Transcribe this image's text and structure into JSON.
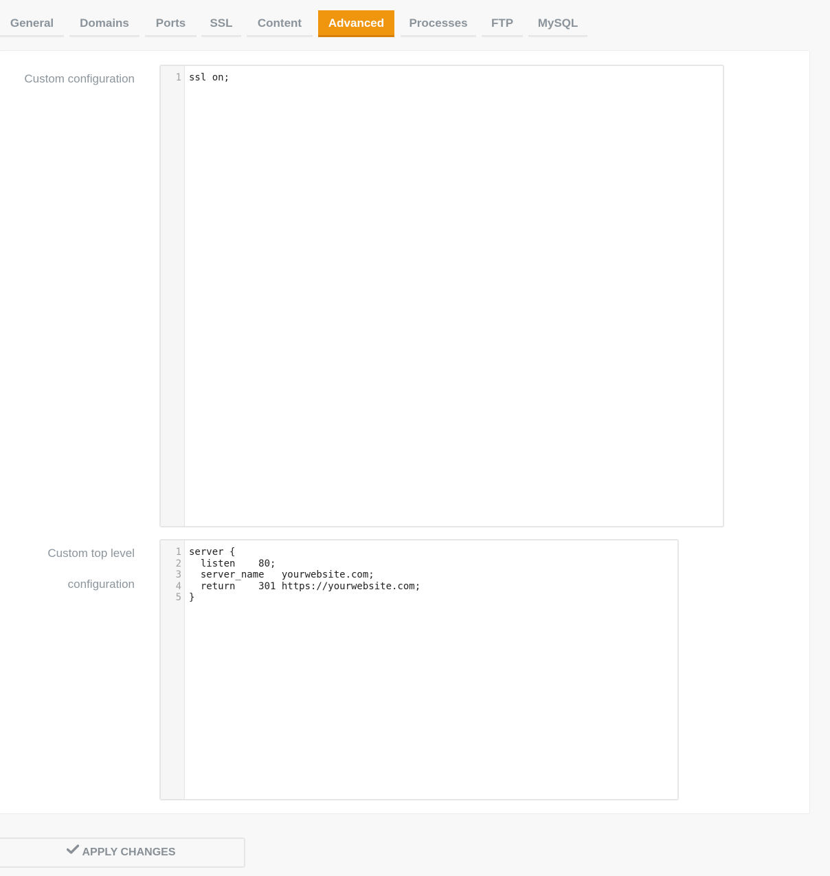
{
  "tabs": [
    {
      "label": "General",
      "active": false
    },
    {
      "label": "Domains",
      "active": false
    },
    {
      "label": "Ports",
      "active": false
    },
    {
      "label": "SSL",
      "active": false
    },
    {
      "label": "Content",
      "active": false
    },
    {
      "label": "Advanced",
      "active": true
    },
    {
      "label": "Processes",
      "active": false
    },
    {
      "label": "FTP",
      "active": false
    },
    {
      "label": "MySQL",
      "active": false
    }
  ],
  "custom_config": {
    "label": "Custom configuration",
    "line_numbers": [
      "1"
    ],
    "code": "ssl on;"
  },
  "custom_top_level": {
    "label_line1": "Custom top level",
    "label_line2": "configuration",
    "line_numbers": [
      "1",
      "2",
      "3",
      "4",
      "5"
    ],
    "code": "server {\n  listen    80;\n  server_name   yourwebsite.com;\n  return    301 https://yourwebsite.com;\n}"
  },
  "apply_button": {
    "label": "APPLY CHANGES",
    "icon": "check-icon"
  },
  "colors": {
    "accent": "#f0950e",
    "tab_text": "#8b939b",
    "label_text": "#8d959c"
  }
}
